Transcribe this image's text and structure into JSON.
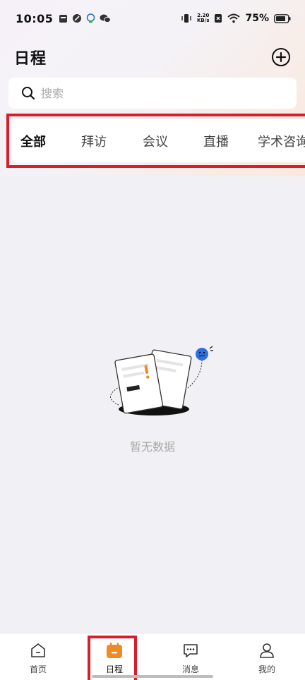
{
  "status_bar": {
    "time": "10:05",
    "net_speed_value": "2.20",
    "net_speed_unit": "KB/s",
    "battery": "75%"
  },
  "header": {
    "title": "日程",
    "add_icon": "plus-circle-icon"
  },
  "search": {
    "placeholder": "搜索",
    "value": ""
  },
  "tabs": [
    {
      "label": "全部",
      "active": true
    },
    {
      "label": "拜访",
      "active": false
    },
    {
      "label": "会议",
      "active": false
    },
    {
      "label": "直播",
      "active": false
    },
    {
      "label": "学术咨询",
      "active": false
    }
  ],
  "empty_state": {
    "message": "暂无数据"
  },
  "bottom_nav": [
    {
      "label": "首页",
      "icon": "home-icon",
      "active": false
    },
    {
      "label": "日程",
      "icon": "calendar-icon",
      "active": true
    },
    {
      "label": "消息",
      "icon": "message-icon",
      "active": false
    },
    {
      "label": "我的",
      "icon": "user-icon",
      "active": false
    }
  ],
  "colors": {
    "accent": "#f08a24",
    "highlight_border": "#d81e2b",
    "background": "#f1f1f5"
  }
}
